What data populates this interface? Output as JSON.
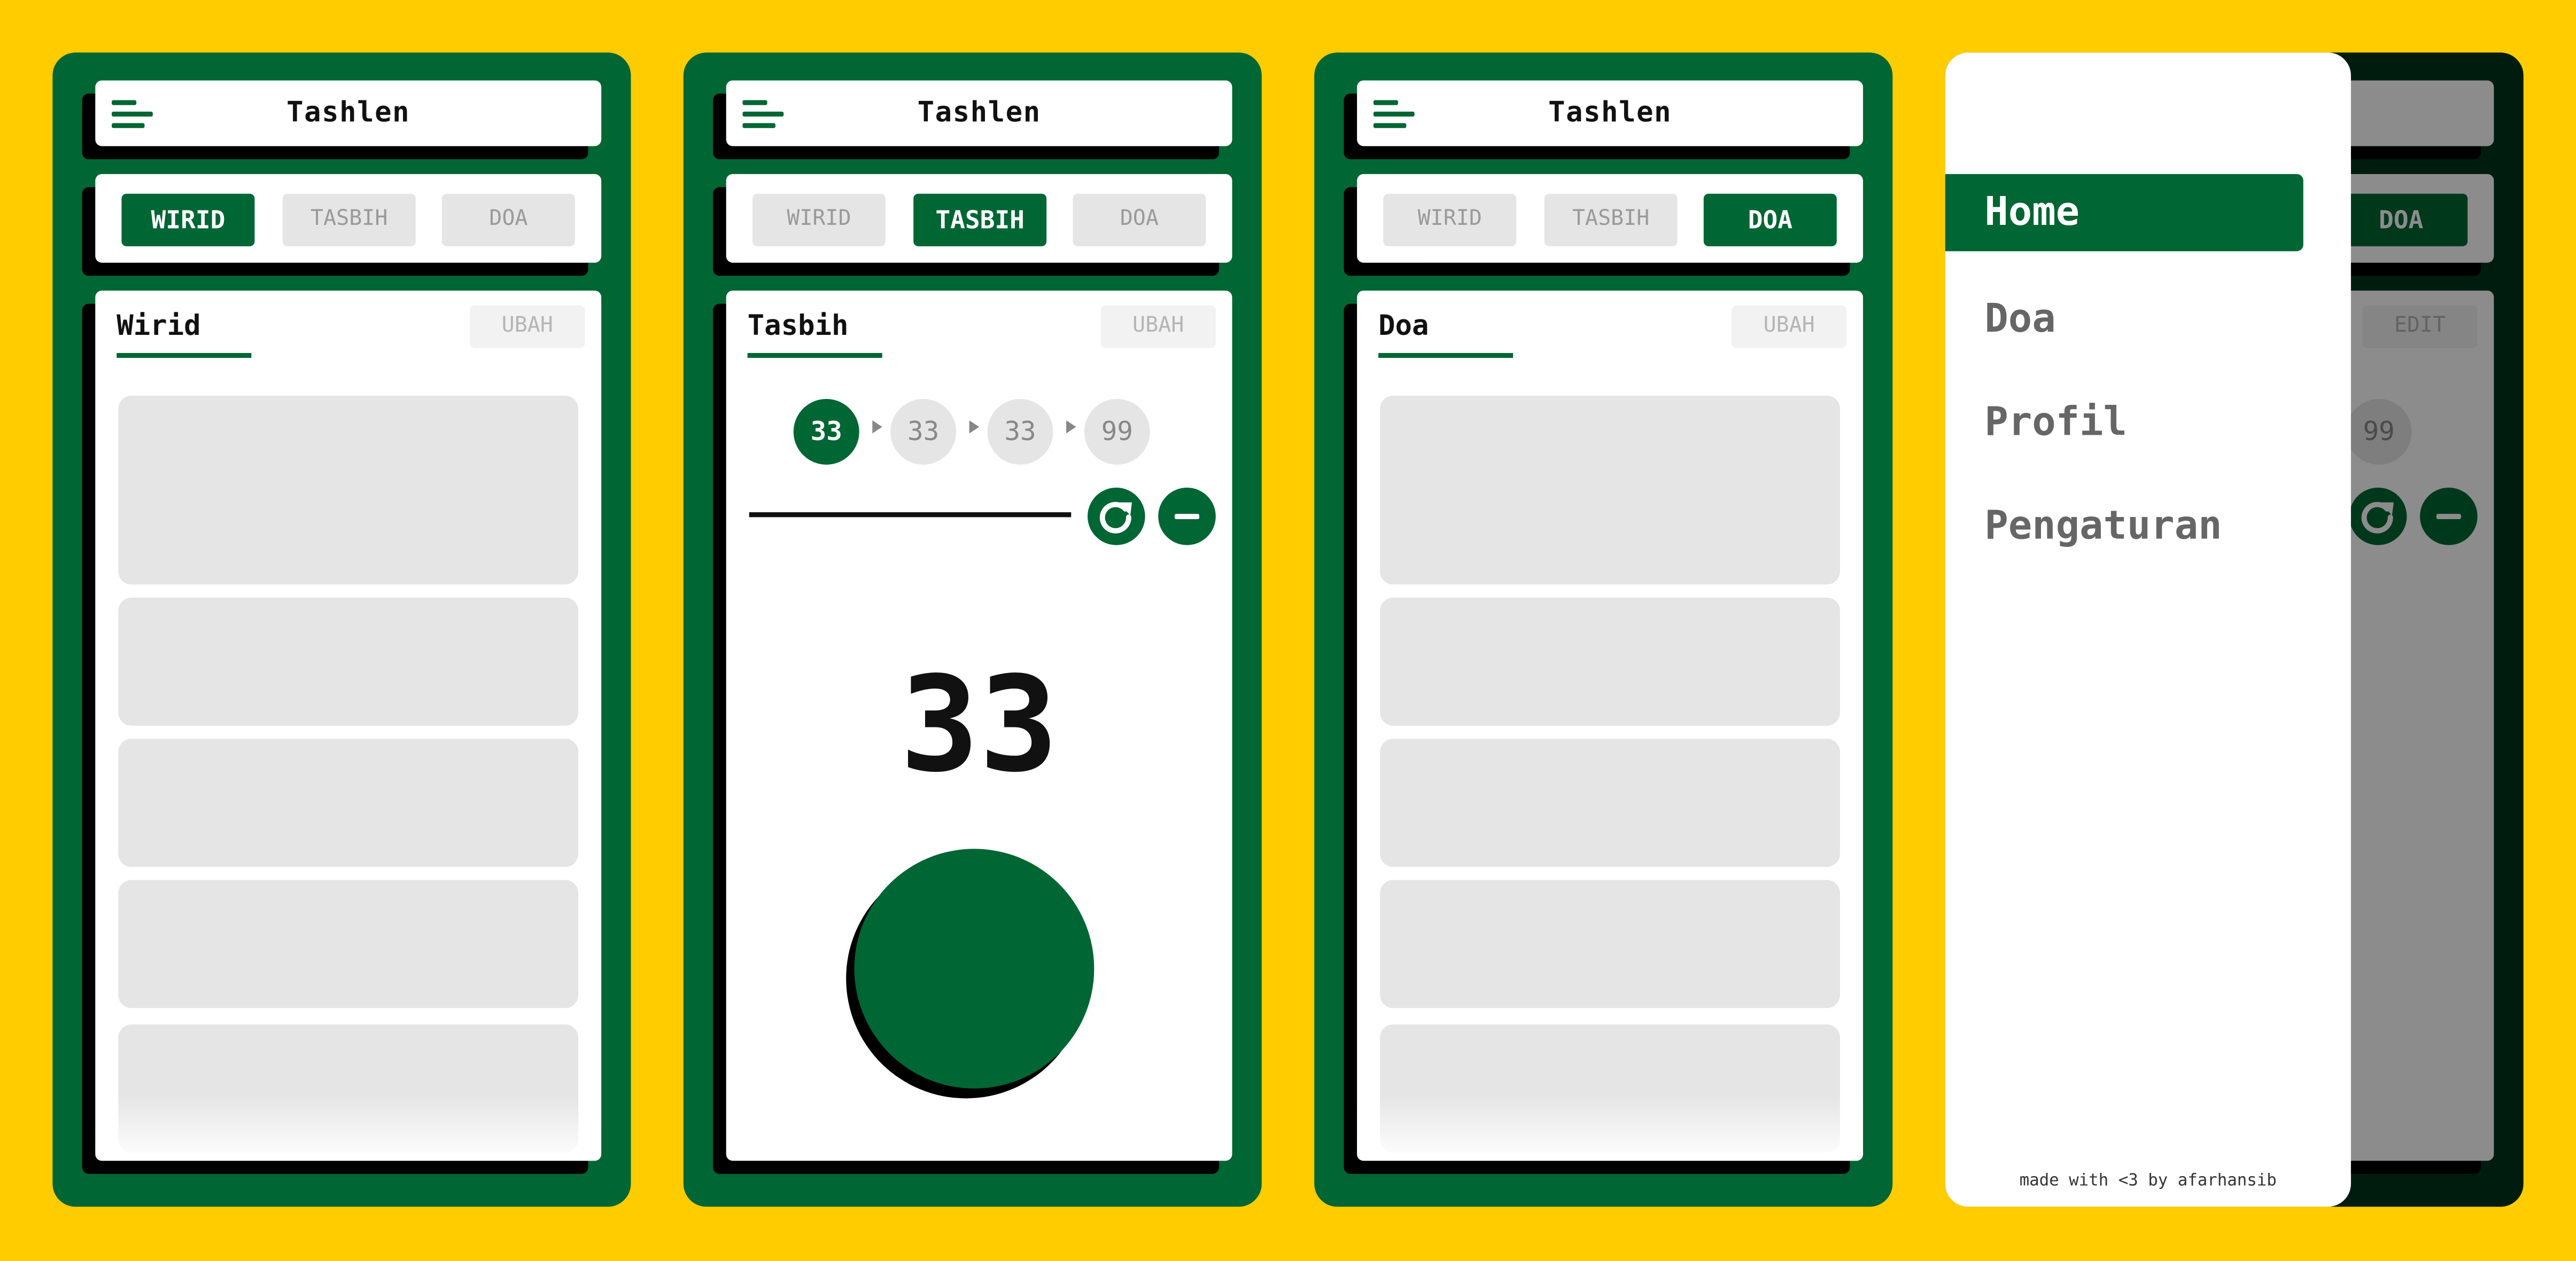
{
  "app": {
    "title": "Tashlen"
  },
  "tabs": [
    "WIRID",
    "TASBIH",
    "DOA"
  ],
  "edit_label": "UBAH",
  "edit_label_en": "EDIT",
  "screens": {
    "wirid": {
      "title": "Wirid",
      "active_tab": 0
    },
    "tasbih": {
      "title": "Tasbih",
      "active_tab": 1,
      "steps": [
        "33",
        "33",
        "33",
        "99"
      ],
      "active_step": 0,
      "counter": "33"
    },
    "doa": {
      "title": "Doa",
      "active_tab": 2
    }
  },
  "drawer": {
    "items": [
      "Home",
      "Doa",
      "Profil",
      "Pengaturan"
    ],
    "active_item": 0,
    "credit": "made with <3 by afarhansib"
  },
  "colors": {
    "background": "#FFCC00",
    "primary": "#006633",
    "placeholder": "#E5E5E5"
  },
  "icons": [
    "menu-icon",
    "reset-icon",
    "minus-icon"
  ]
}
